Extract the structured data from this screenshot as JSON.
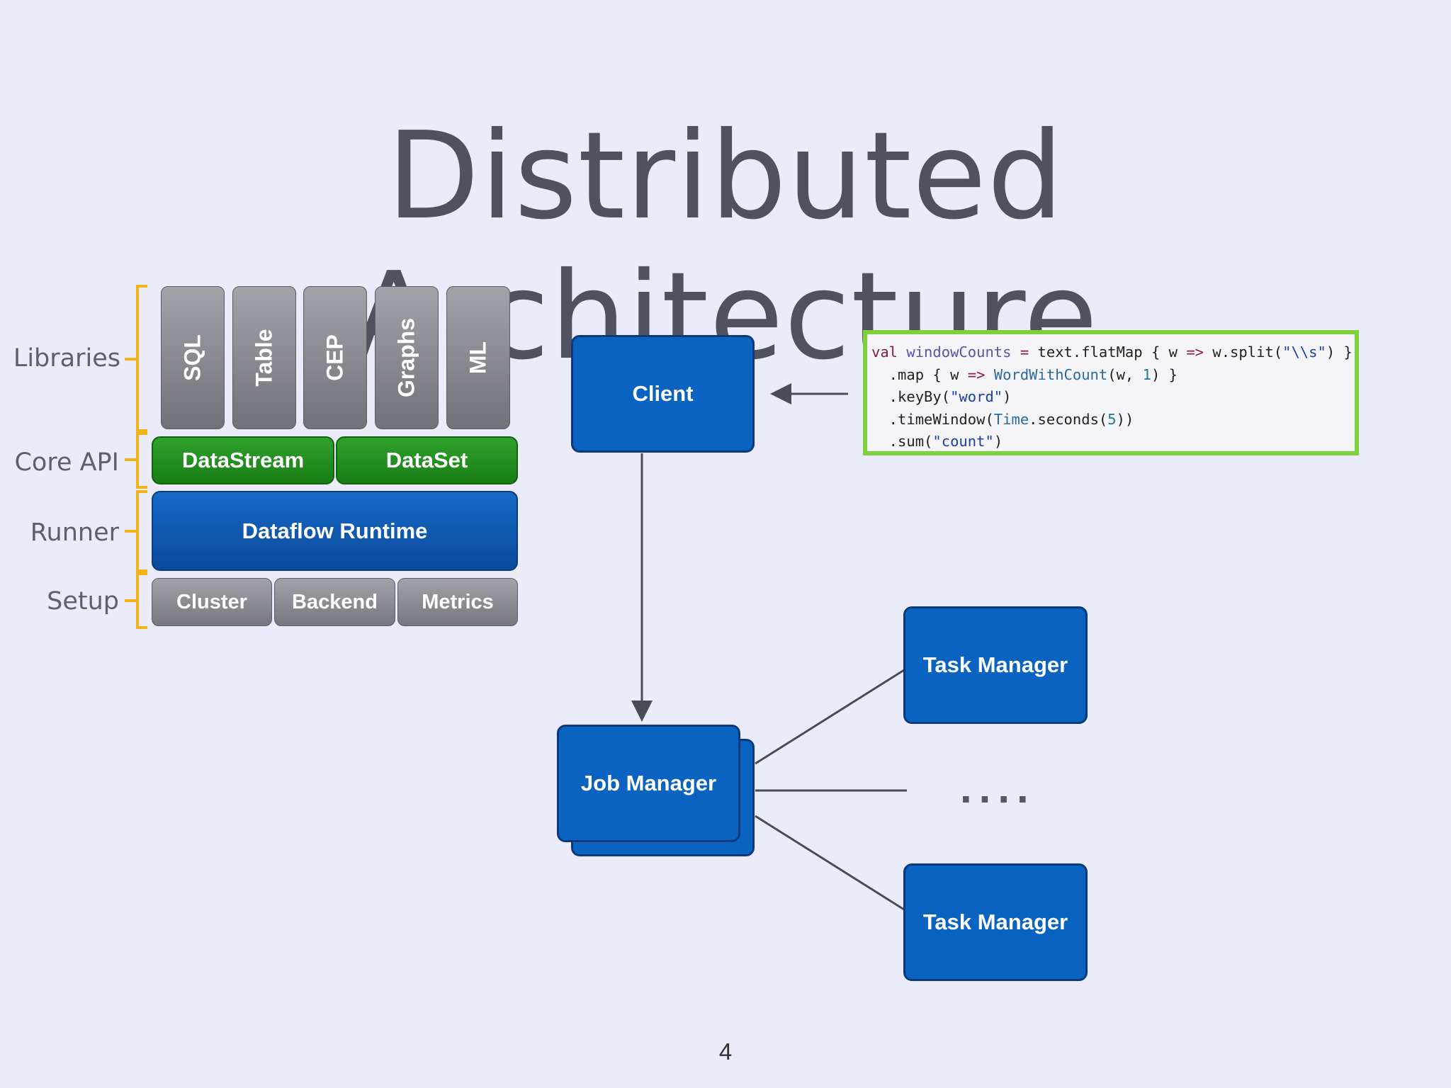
{
  "slide": {
    "title": "Distributed Architecture",
    "page_number": "4"
  },
  "stack": {
    "layers": {
      "libraries": "Libraries",
      "core_api": "Core API",
      "runner": "Runner",
      "setup": "Setup"
    },
    "libraries": [
      "SQL",
      "Table",
      "CEP",
      "Graphs",
      "ML"
    ],
    "core_api": [
      "DataStream",
      "DataSet"
    ],
    "runner": "Dataflow Runtime",
    "setup": [
      "Cluster",
      "Backend",
      "Metrics"
    ]
  },
  "cluster": {
    "client": "Client",
    "job_manager": "Job Manager",
    "task_manager_top": "Task Manager",
    "task_manager_bottom": "Task Manager",
    "ellipsis": "...."
  },
  "code": {
    "line1": {
      "kw": "val",
      "name": "windowCounts",
      "op": "=",
      "rest1": "text.flatMap { w",
      "arrow": "=>",
      "rest2": "w.split(",
      "str": "\"\\\\s\"",
      "rest3": ") }"
    },
    "line2": {
      "pre": "  .map { w",
      "arrow": "=>",
      "type": "WordWithCount",
      "mid": "(w,",
      "num": "1",
      "post": ") }"
    },
    "line3": {
      "pre": "  .keyBy(",
      "str": "\"word\"",
      "post": ")"
    },
    "line4": {
      "pre": "  .timeWindow(",
      "type": "Time",
      "mid": ".seconds(",
      "num": "5",
      "post": "))"
    },
    "line5": {
      "pre": "  .sum(",
      "str": "\"count\"",
      "post": ")"
    }
  },
  "colors": {
    "background": "#ebebf9",
    "blue_node": "#0a63c1",
    "green_api": "#1f8c1b",
    "bracket": "#f2b418",
    "code_border": "#7fd13b"
  }
}
